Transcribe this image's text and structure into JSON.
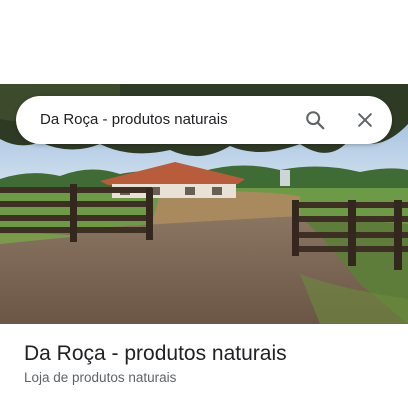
{
  "search": {
    "query": "Da Roça - produtos naturais"
  },
  "icons": {
    "search": "search-icon",
    "close": "close-icon"
  },
  "place": {
    "name": "Da Roça - produtos naturais",
    "category": "Loja de produtos naturais"
  },
  "colors": {
    "title_text": "#202124",
    "secondary_text": "#5f6368",
    "icon": "#5f6368"
  }
}
